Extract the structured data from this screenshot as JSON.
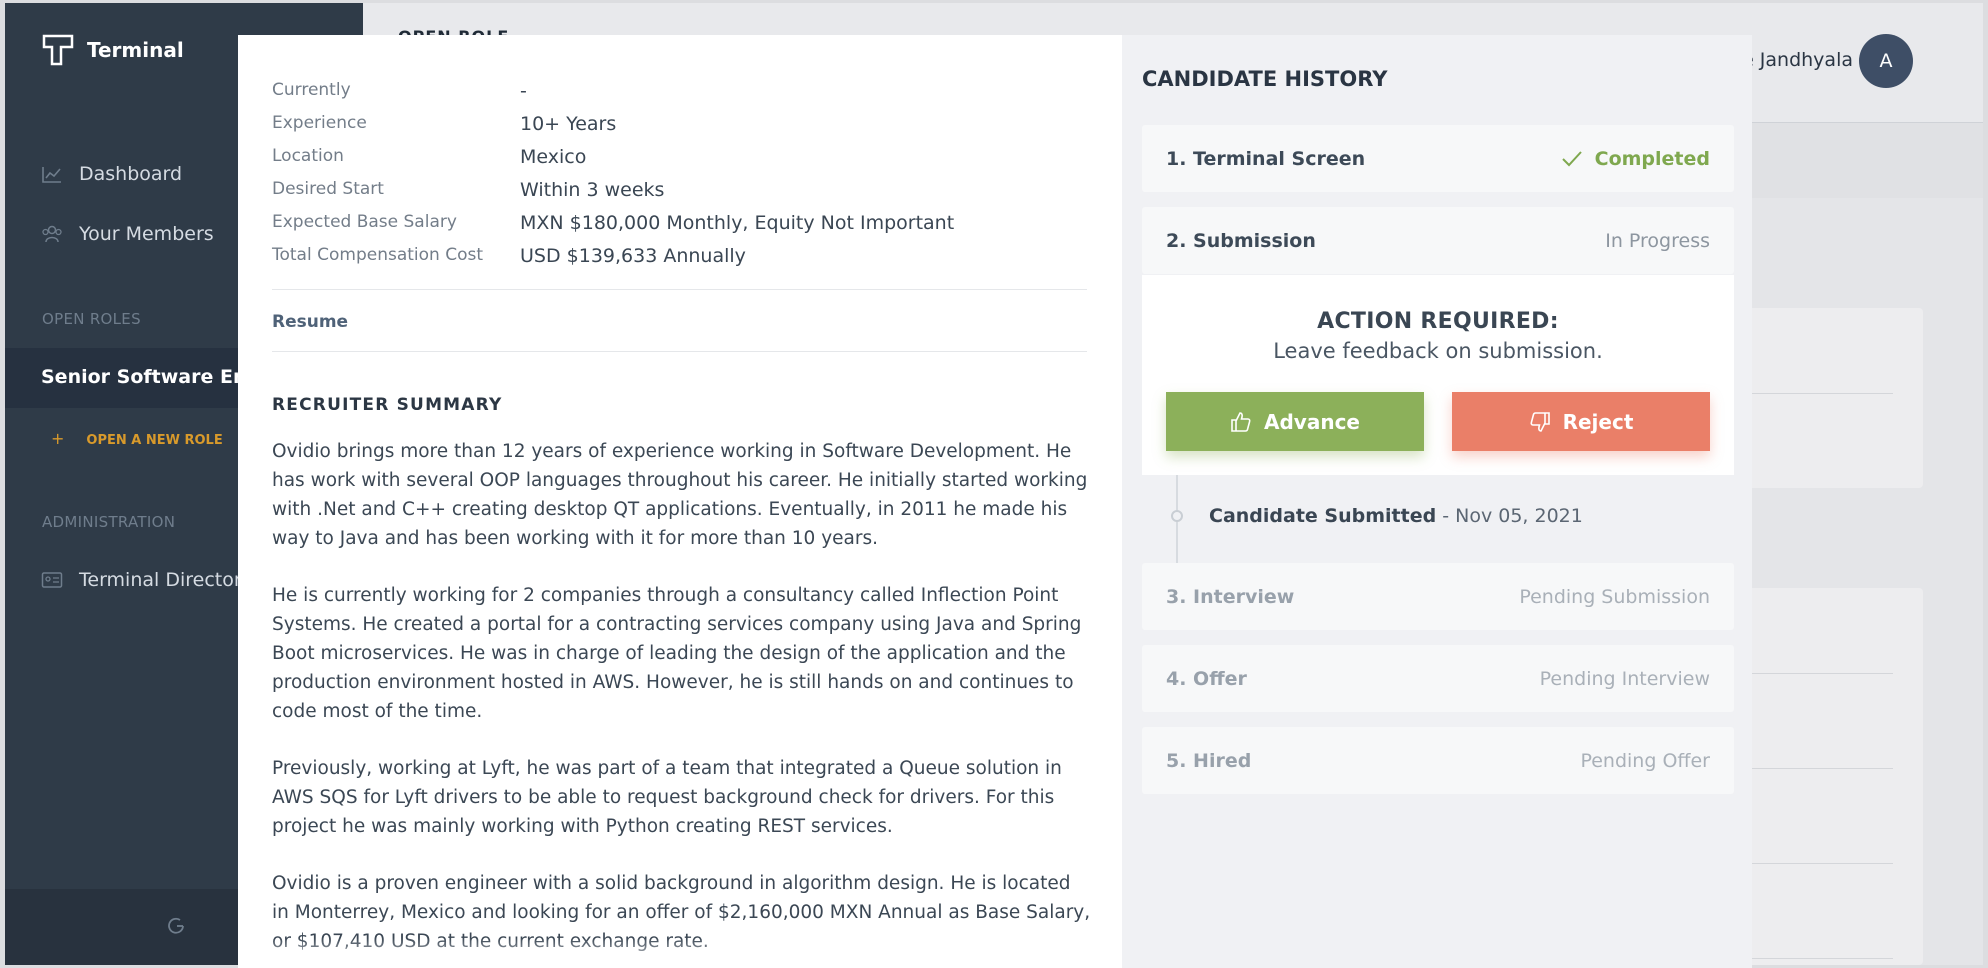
{
  "sidebar": {
    "logo_text": "Terminal",
    "nav": [
      {
        "label": "Dashboard",
        "icon": "chart-icon"
      },
      {
        "label": "Your Members",
        "icon": "members-icon"
      }
    ],
    "open_roles_heading": "OPEN ROLES",
    "active_role": "Senior Software Engi",
    "new_role_plus": "+",
    "new_role_label": "OPEN A NEW ROLE",
    "admin_heading": "ADMINISTRATION",
    "admin_item": "Terminal Directory",
    "footer_icon": "refresh-icon"
  },
  "header": {
    "open_role_peek": "OPEN ROLE",
    "user_name": "e Jandhyala",
    "avatar_initial": "A"
  },
  "candidate": {
    "details": [
      {
        "label": "Currently",
        "value": "-"
      },
      {
        "label": "Experience",
        "value": "10+ Years"
      },
      {
        "label": "Location",
        "value": "Mexico"
      },
      {
        "label": "Desired Start",
        "value": "Within 3 weeks"
      },
      {
        "label": "Expected Base Salary",
        "value": "MXN $180,000 Monthly, Equity Not Important"
      },
      {
        "label": "Total Compensation Cost",
        "value": "USD $139,633 Annually"
      }
    ],
    "resume_label": "Resume",
    "summary_heading": "RECRUITER SUMMARY",
    "summary": [
      "Ovidio brings more than 12 years of experience working in Software Development. He has work with several OOP languages throughout his career. He initially started working with .Net and C++ creating desktop QT applications. Eventually, in 2011 he made his way to Java and has been working with it for more than 10 years.",
      "He is currently working for 2 companies through a consultancy called Inflection Point Systems. He created a portal for a contracting services company using Java and Spring Boot microservices. He was in charge of leading the design of the application and the production environment hosted in AWS. However, he is still hands on and continues to code most of the time.",
      "Previously, working at Lyft, he was part of a team that integrated a Queue solution in AWS SQS for Lyft drivers to be able to request background check for drivers. For this project he was mainly working with Python creating REST services.",
      "Ovidio is a proven engineer with a solid background in algorithm design. He is located in Monterrey, Mexico and looking for an offer of $2,160,000 MXN Annual as Base Salary, or $107,410 USD at the current exchange rate."
    ]
  },
  "history": {
    "title": "CANDIDATE HISTORY",
    "stages": [
      {
        "name": "1.  Terminal Screen",
        "status": "Completed"
      },
      {
        "name": "2.  Submission",
        "status": "In Progress"
      },
      {
        "name": "3.  Interview",
        "status": "Pending Submission"
      },
      {
        "name": "4.  Offer",
        "status": "Pending Interview"
      },
      {
        "name": "5.  Hired",
        "status": "Pending Offer"
      }
    ],
    "action_title": "ACTION REQUIRED:",
    "action_subtitle": "Leave feedback on submission.",
    "advance_label": "Advance",
    "reject_label": "Reject",
    "timeline_event": "Candidate Submitted",
    "timeline_date": " - Nov 05, 2021"
  },
  "colors": {
    "sidebar_bg": "#2f3b48",
    "completed": "#7fa84f",
    "advance": "#8cb05a",
    "reject": "#ea7f68",
    "accent_orange": "#d99a2b"
  }
}
